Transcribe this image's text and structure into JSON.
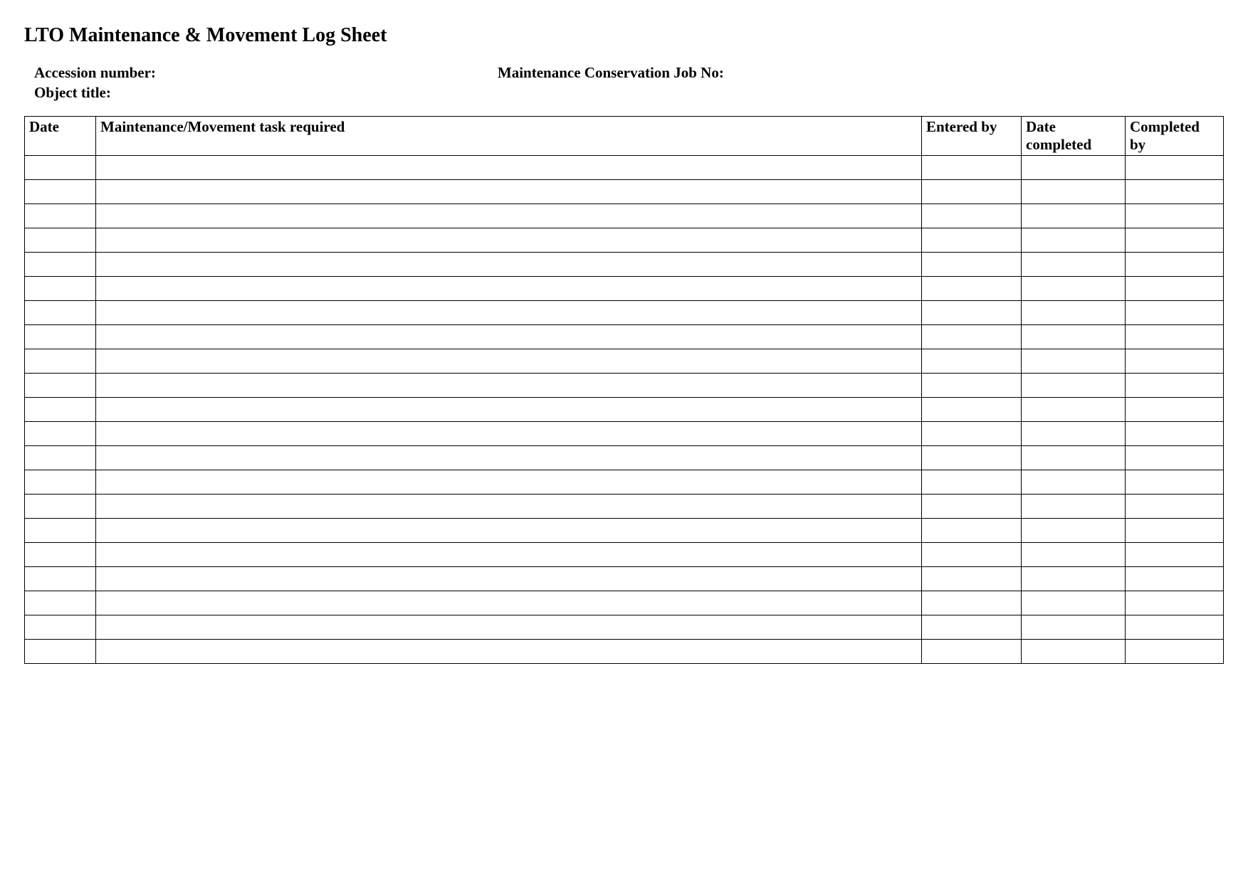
{
  "title": "LTO Maintenance & Movement Log Sheet",
  "meta": {
    "accession_label": "Accession number:",
    "accession_value": "",
    "object_label": "Object title:",
    "object_value": "",
    "jobno_label": "Maintenance Conservation Job No:",
    "jobno_value": ""
  },
  "table": {
    "headers": {
      "date": "Date",
      "task": "Maintenance/Movement task required",
      "entered_by": "Entered by",
      "date_completed": "Date completed",
      "completed_by": "Completed by"
    },
    "rows": [
      {
        "date": "",
        "task": "",
        "entered_by": "",
        "date_completed": "",
        "completed_by": ""
      },
      {
        "date": "",
        "task": "",
        "entered_by": "",
        "date_completed": "",
        "completed_by": ""
      },
      {
        "date": "",
        "task": "",
        "entered_by": "",
        "date_completed": "",
        "completed_by": ""
      },
      {
        "date": "",
        "task": "",
        "entered_by": "",
        "date_completed": "",
        "completed_by": ""
      },
      {
        "date": "",
        "task": "",
        "entered_by": "",
        "date_completed": "",
        "completed_by": ""
      },
      {
        "date": "",
        "task": "",
        "entered_by": "",
        "date_completed": "",
        "completed_by": ""
      },
      {
        "date": "",
        "task": "",
        "entered_by": "",
        "date_completed": "",
        "completed_by": ""
      },
      {
        "date": "",
        "task": "",
        "entered_by": "",
        "date_completed": "",
        "completed_by": ""
      },
      {
        "date": "",
        "task": "",
        "entered_by": "",
        "date_completed": "",
        "completed_by": ""
      },
      {
        "date": "",
        "task": "",
        "entered_by": "",
        "date_completed": "",
        "completed_by": ""
      },
      {
        "date": "",
        "task": "",
        "entered_by": "",
        "date_completed": "",
        "completed_by": ""
      },
      {
        "date": "",
        "task": "",
        "entered_by": "",
        "date_completed": "",
        "completed_by": ""
      },
      {
        "date": "",
        "task": "",
        "entered_by": "",
        "date_completed": "",
        "completed_by": ""
      },
      {
        "date": "",
        "task": "",
        "entered_by": "",
        "date_completed": "",
        "completed_by": ""
      },
      {
        "date": "",
        "task": "",
        "entered_by": "",
        "date_completed": "",
        "completed_by": ""
      },
      {
        "date": "",
        "task": "",
        "entered_by": "",
        "date_completed": "",
        "completed_by": ""
      },
      {
        "date": "",
        "task": "",
        "entered_by": "",
        "date_completed": "",
        "completed_by": ""
      },
      {
        "date": "",
        "task": "",
        "entered_by": "",
        "date_completed": "",
        "completed_by": ""
      },
      {
        "date": "",
        "task": "",
        "entered_by": "",
        "date_completed": "",
        "completed_by": ""
      },
      {
        "date": "",
        "task": "",
        "entered_by": "",
        "date_completed": "",
        "completed_by": ""
      },
      {
        "date": "",
        "task": "",
        "entered_by": "",
        "date_completed": "",
        "completed_by": ""
      }
    ]
  }
}
